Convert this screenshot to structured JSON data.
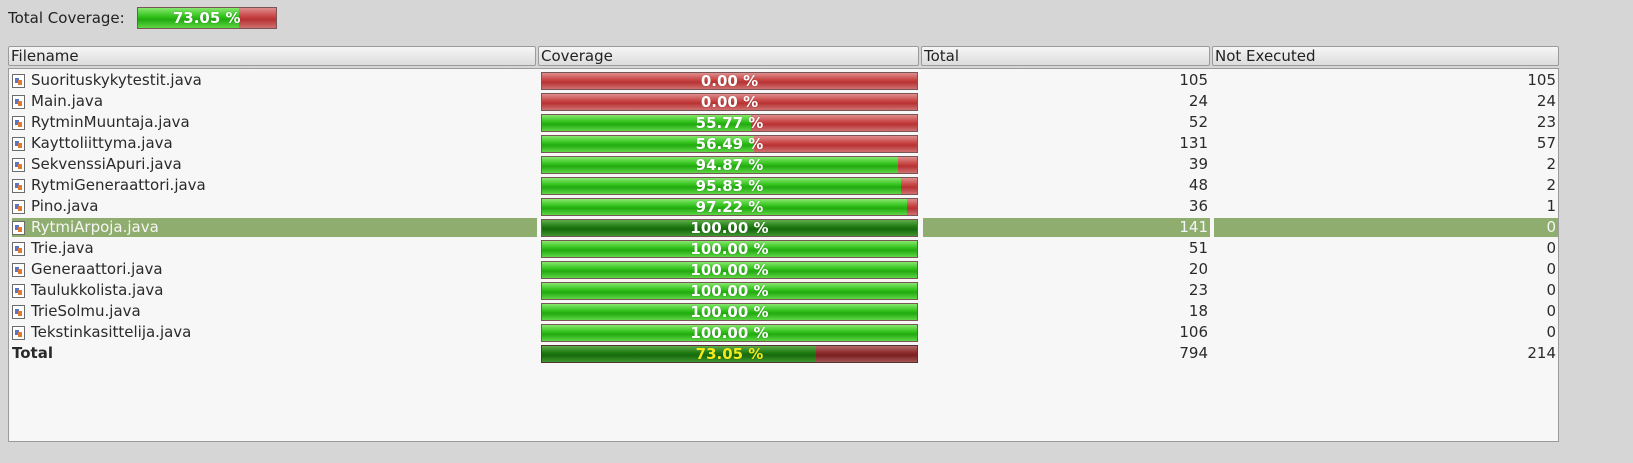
{
  "header": {
    "total_coverage_label": "Total Coverage:",
    "total_coverage_text": "73.05 %",
    "total_coverage_fraction": 0.7305
  },
  "columns": {
    "filename": "Filename",
    "coverage": "Coverage",
    "total": "Total",
    "not_executed": "Not Executed"
  },
  "colors": {
    "covered": "#2fbd1a",
    "uncovered": "#c03c3c",
    "selected_row": "#8fad6e",
    "total_text": "#f2ea1a"
  },
  "rows": [
    {
      "filename": "Suorituskykytestit.java",
      "coverage_text": "0.00 %",
      "coverage_fraction": 0.0,
      "total": "105",
      "not_executed": "105"
    },
    {
      "filename": "Main.java",
      "coverage_text": "0.00 %",
      "coverage_fraction": 0.0,
      "total": "24",
      "not_executed": "24"
    },
    {
      "filename": "RytminMuuntaja.java",
      "coverage_text": "55.77 %",
      "coverage_fraction": 0.5577,
      "total": "52",
      "not_executed": "23"
    },
    {
      "filename": "Kayttoliittyma.java",
      "coverage_text": "56.49 %",
      "coverage_fraction": 0.5649,
      "total": "131",
      "not_executed": "57"
    },
    {
      "filename": "SekvenssiApuri.java",
      "coverage_text": "94.87 %",
      "coverage_fraction": 0.9487,
      "total": "39",
      "not_executed": "2"
    },
    {
      "filename": "RytmiGeneraattori.java",
      "coverage_text": "95.83 %",
      "coverage_fraction": 0.9583,
      "total": "48",
      "not_executed": "2"
    },
    {
      "filename": "Pino.java",
      "coverage_text": "97.22 %",
      "coverage_fraction": 0.9722,
      "total": "36",
      "not_executed": "1"
    },
    {
      "filename": "RytmiArpoja.java",
      "coverage_text": "100.00 %",
      "coverage_fraction": 1.0,
      "total": "141",
      "not_executed": "0",
      "selected": true
    },
    {
      "filename": "Trie.java",
      "coverage_text": "100.00 %",
      "coverage_fraction": 1.0,
      "total": "51",
      "not_executed": "0"
    },
    {
      "filename": "Generaattori.java",
      "coverage_text": "100.00 %",
      "coverage_fraction": 1.0,
      "total": "20",
      "not_executed": "0"
    },
    {
      "filename": "Taulukkolista.java",
      "coverage_text": "100.00 %",
      "coverage_fraction": 1.0,
      "total": "23",
      "not_executed": "0"
    },
    {
      "filename": "TrieSolmu.java",
      "coverage_text": "100.00 %",
      "coverage_fraction": 1.0,
      "total": "18",
      "not_executed": "0"
    },
    {
      "filename": "Tekstinkasittelija.java",
      "coverage_text": "100.00 %",
      "coverage_fraction": 1.0,
      "total": "106",
      "not_executed": "0"
    }
  ],
  "total_row": {
    "label": "Total",
    "coverage_text": "73.05 %",
    "coverage_fraction": 0.7305,
    "total": "794",
    "not_executed": "214"
  }
}
